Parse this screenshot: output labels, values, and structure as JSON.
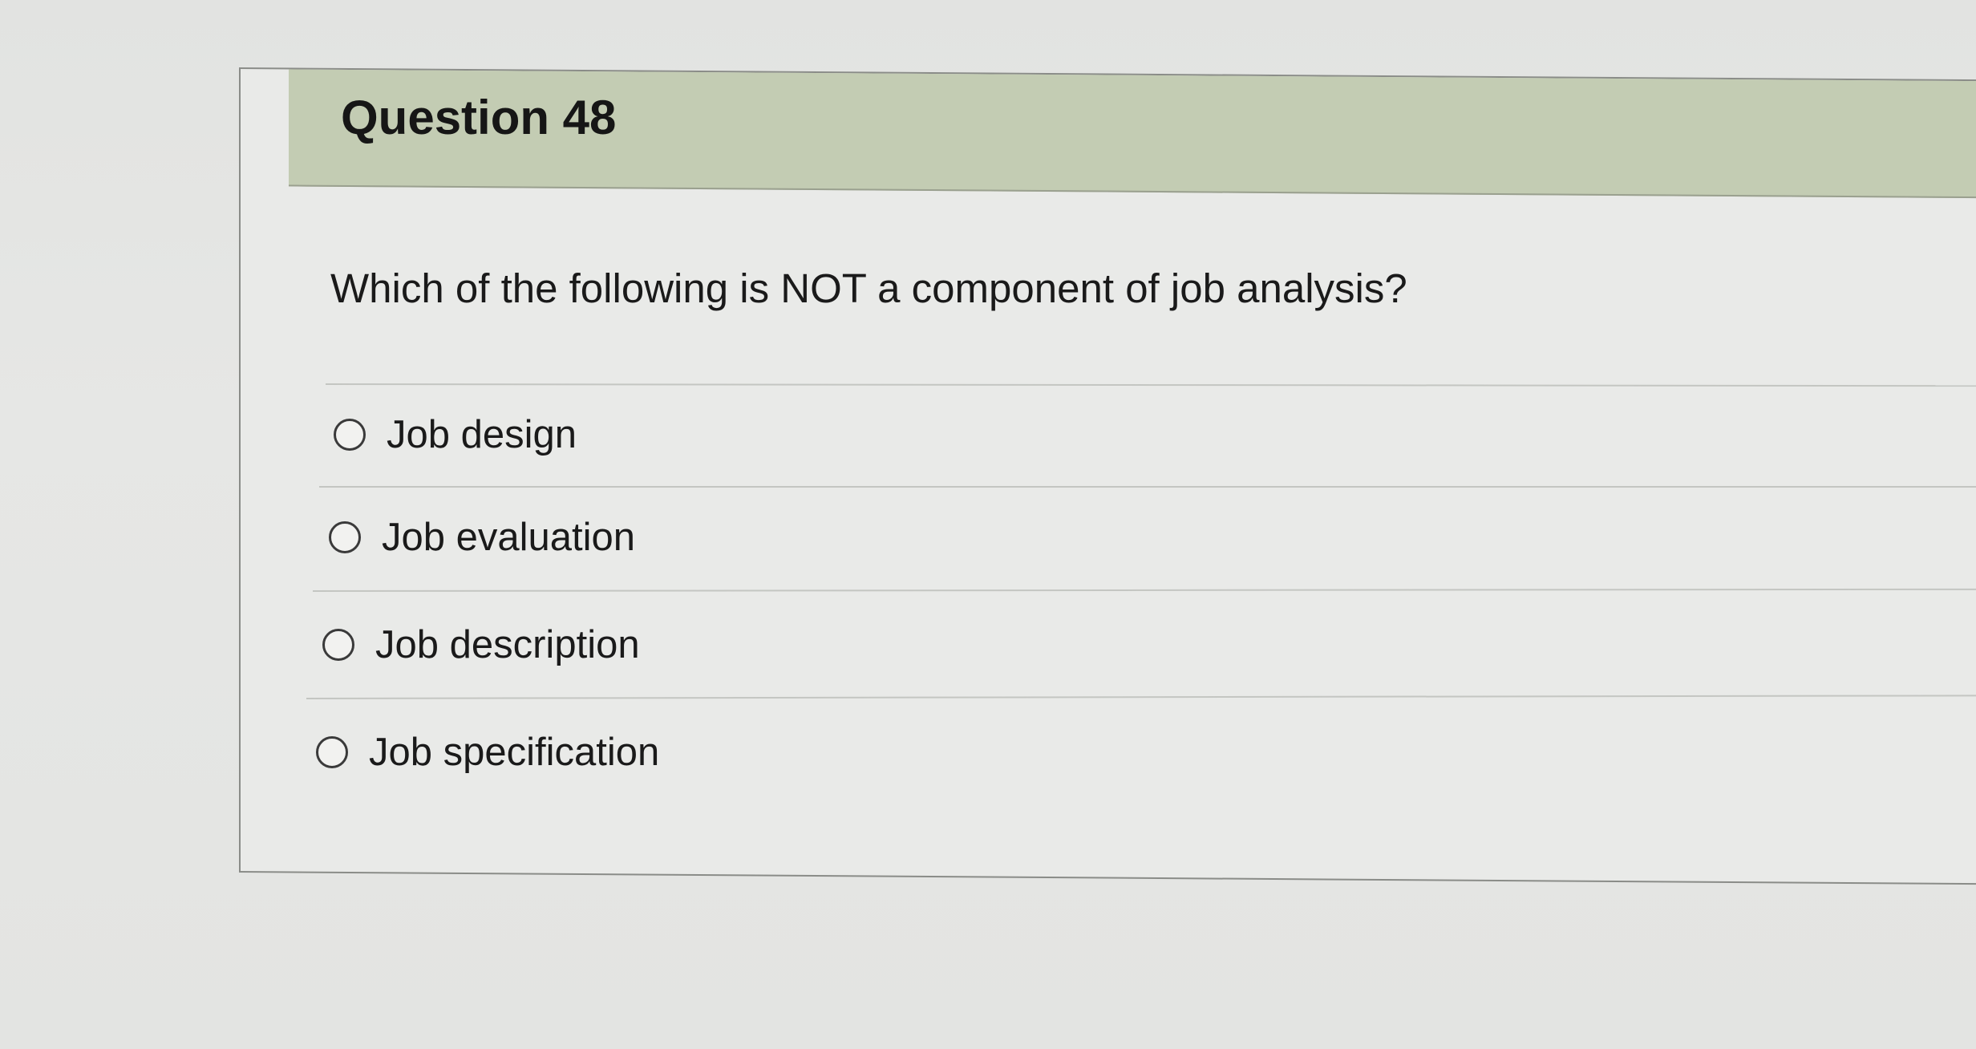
{
  "question": {
    "title": "Question 48",
    "prompt": "Which of the following is NOT a component of job analysis?",
    "options": [
      {
        "label": "Job design",
        "selected": false
      },
      {
        "label": "Job evaluation",
        "selected": false
      },
      {
        "label": "Job description",
        "selected": false
      },
      {
        "label": "Job specification",
        "selected": false
      }
    ]
  },
  "colors": {
    "header_background": "#c3ccb3",
    "card_background": "#e9eae8",
    "page_background": "#e4e5e3"
  }
}
